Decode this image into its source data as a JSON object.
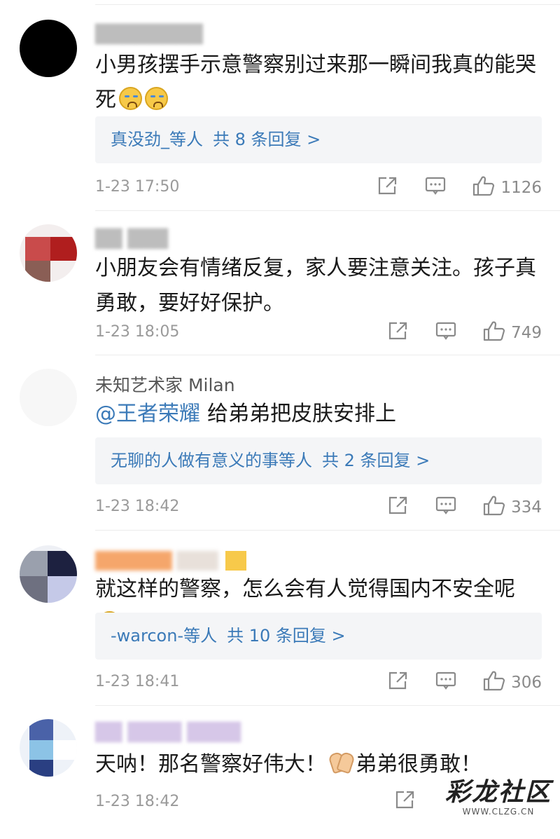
{
  "comments": [
    {
      "username": "",
      "text": "小男孩摆手示意警察别过来那一瞬间我真的能哭死",
      "emojis": [
        "crying-face",
        "crying-face"
      ],
      "replies": {
        "users": "真没劲_等人",
        "count": "共 8 条回复 >"
      },
      "time": "1-23 17:50",
      "likes": "1126"
    },
    {
      "username": "",
      "text": "小朋友会有情绪反复，家人要注意关注。孩子真勇敢，要好好保护。",
      "time": "1-23 18:05",
      "likes": "749"
    },
    {
      "username": "未知艺术家 Milan",
      "mention": "@王者荣耀",
      "text": "给弟弟把皮肤安排上",
      "replies": {
        "users": "无聊的人做有意义的事等人",
        "count": "共 2 条回复 >"
      },
      "time": "1-23 18:42",
      "likes": "334"
    },
    {
      "username": "",
      "text": "就这样的警察，怎么会有人觉得国内不安全呢",
      "emojis": [
        "crying-face"
      ],
      "replies": {
        "users": "-warcon-等人",
        "count": "共 10 条回复 >"
      },
      "time": "1-23 18:41",
      "likes": "306"
    },
    {
      "username": "",
      "text_before": "天呐！那名警察好伟大！",
      "text_after": "弟弟很勇敢！",
      "emojis": [
        "praying-hands"
      ],
      "time": "1-23 18:42",
      "likes": ""
    }
  ],
  "watermark": {
    "main": "彩龙社区",
    "sub": "WWW.CLZG.CN"
  },
  "colors": {
    "link": "#3b7ab8",
    "meta": "#9a9a9a",
    "reply_bg": "#f4f5f7",
    "divider": "#ececec"
  }
}
